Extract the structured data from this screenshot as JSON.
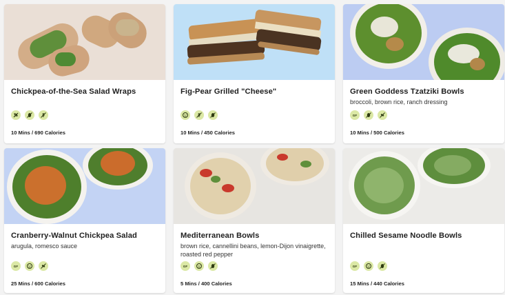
{
  "recipes": [
    {
      "title": "Chickpea-of-the-Sea Salad Wraps",
      "subtitle": "",
      "icons": [
        "plant-based-icon",
        "no-nuts-icon",
        "no-gluten-icon"
      ],
      "meta": "10 Mins / 690 Calories"
    },
    {
      "title": "Fig-Pear Grilled \"Cheese\"",
      "subtitle": "",
      "icons": [
        "kid-friendly-icon",
        "no-gluten-icon",
        "no-nuts-icon"
      ],
      "meta": "10 Mins / 450 Calories"
    },
    {
      "title": "Green Goddess Tzatziki Bowls",
      "subtitle": "broccoli, brown rice, ranch dressing",
      "icons": [
        "gluten-free-icon",
        "no-nuts-icon",
        "no-soy-icon"
      ],
      "meta": "10 Mins / 500 Calories"
    },
    {
      "title": "Cranberry-Walnut Chickpea Salad",
      "subtitle": "arugula, romesco sauce",
      "icons": [
        "gluten-free-icon",
        "kid-friendly-icon",
        "no-soy-icon"
      ],
      "meta": "25 Mins / 600 Calories"
    },
    {
      "title": "Mediterranean Bowls",
      "subtitle": "brown rice, cannellini beans, lemon-Dijon vinaigrette, roasted red pepper",
      "icons": [
        "gluten-free-icon",
        "kid-friendly-icon",
        "no-nuts-icon"
      ],
      "meta": "5 Mins / 400 Calories"
    },
    {
      "title": "Chilled Sesame Noodle Bowls",
      "subtitle": "",
      "icons": [
        "gluten-free-icon",
        "kid-friendly-icon",
        "no-nuts-icon"
      ],
      "meta": "15 Mins / 440 Calories"
    }
  ],
  "colors": {
    "icon_badge": "#dbe8a5",
    "icon_stroke": "#2f3b12"
  }
}
